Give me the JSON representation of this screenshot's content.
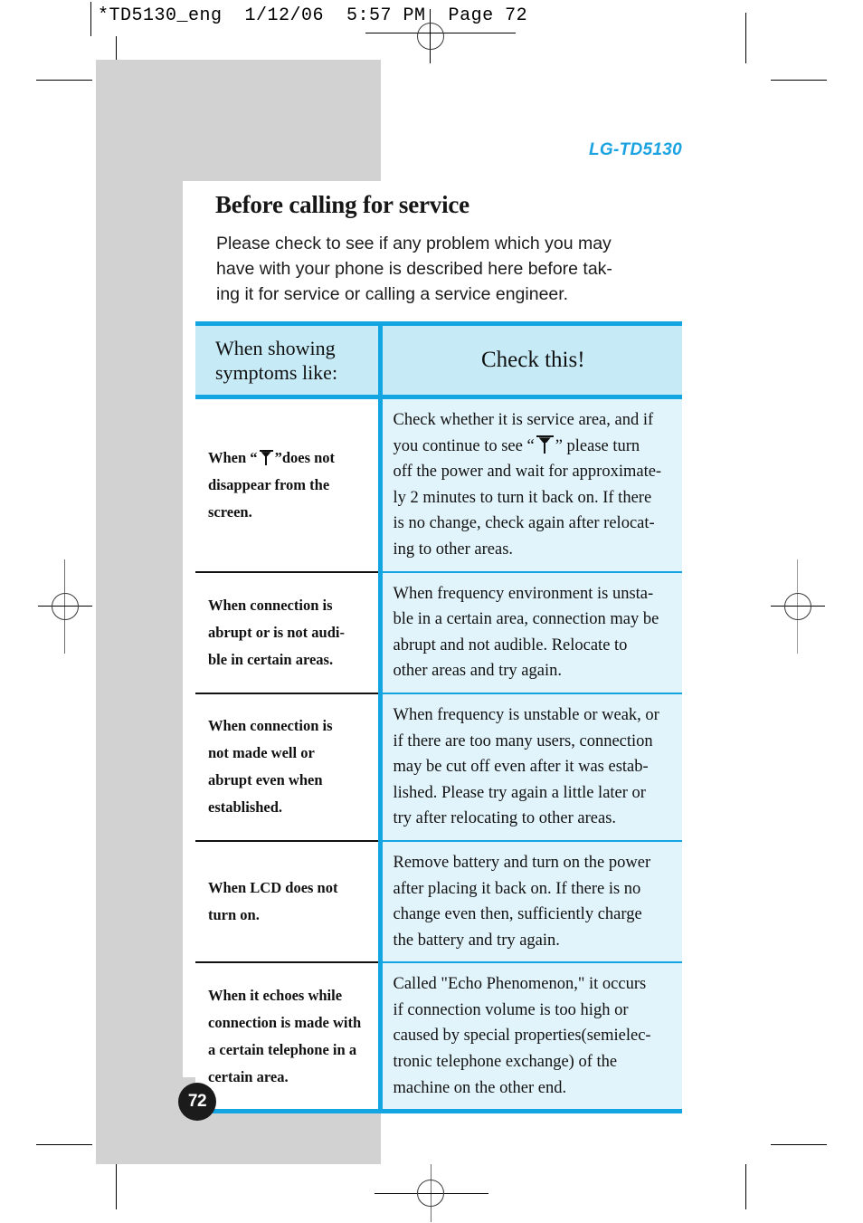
{
  "print_header": {
    "text": "*TD5130_eng  1/12/06  5:57 PM  Page 72"
  },
  "brand": {
    "label": "LG-TD5130",
    "color": "#1aa3e0"
  },
  "page": {
    "title": "Before calling for service",
    "number": "72",
    "intro_lines": [
      "Please check to see if any problem which you may",
      "have with your phone is described here before tak-",
      "ing it for service or calling a service engineer."
    ]
  },
  "table": {
    "header": {
      "left_lines": [
        "When showing",
        "symptoms like:"
      ],
      "right": "Check this!"
    },
    "border_color": "#13a5e1",
    "header_bg": "#c6ebf7",
    "body_bg": "#e2f4fb",
    "rows": [
      {
        "symptom_lines": [
          {
            "pre": "When “",
            "icon": "antenna-icon",
            "post": "”does not"
          },
          {
            "text": "disappear  from  the"
          },
          {
            "text": "screen."
          }
        ],
        "check_lines": [
          {
            "text": "Check whether it is service area, and if"
          },
          {
            "pre": "you continue to see “",
            "icon": "antenna-icon",
            "post": "” please turn"
          },
          {
            "text": "off the power and wait for approximate-"
          },
          {
            "text": "ly 2 minutes to turn it back on.  If there"
          },
          {
            "text": "is no change, check again after relocat-"
          },
          {
            "text": "ing to other areas.",
            "last": true
          }
        ]
      },
      {
        "symptom_lines": [
          {
            "text": "When   connection   is"
          },
          {
            "text": "abrupt or is not audi-"
          },
          {
            "text": "ble in certain areas.",
            "last": true
          }
        ],
        "check_lines": [
          {
            "text": "When frequency environment is unsta-"
          },
          {
            "text": "ble in a certain area, connection may be"
          },
          {
            "text": "abrupt  and  not  audible.  Relocate  to"
          },
          {
            "text": "other areas and try again.",
            "last": true
          }
        ]
      },
      {
        "symptom_lines": [
          {
            "text": "When connection is",
            "last": true
          },
          {
            "text": "not made well or",
            "last": true
          },
          {
            "text": "abrupt even when",
            "last": true
          },
          {
            "text": "established.",
            "last": true
          }
        ],
        "check_lines": [
          {
            "text": "When frequency is unstable or weak, or"
          },
          {
            "text": "if there are too many users, connection"
          },
          {
            "text": "may be cut off even after it was estab-"
          },
          {
            "text": "lished.  Please try again a little later or"
          },
          {
            "text": "try after relocating to other areas.",
            "last": true
          }
        ]
      },
      {
        "symptom_lines": [
          {
            "text": "When LCD does not",
            "last": true
          },
          {
            "text": "turn on.",
            "last": true
          }
        ],
        "check_lines": [
          {
            "text": "Remove battery and turn on the power"
          },
          {
            "text": "after placing it back on.  If there is no"
          },
          {
            "text": "change even then, sufficiently charge"
          },
          {
            "text": "the battery and try again.",
            "last": true
          }
        ]
      },
      {
        "symptom_lines": [
          {
            "text": "When  it  echoes  while"
          },
          {
            "text": "connection is made with"
          },
          {
            "text": "a certain telephone in a"
          },
          {
            "text": "certain area.",
            "last": true
          }
        ],
        "check_lines": [
          {
            "text": "Called \"Echo Phenomenon,\" it  occurs"
          },
          {
            "text": "if  connection  volume  is  too  high  or"
          },
          {
            "text": "caused by special properties(semielec-"
          },
          {
            "text": "tronic  telephone  exchange)  of  the"
          },
          {
            "text": "machine on the other end.",
            "last": true
          }
        ]
      }
    ]
  }
}
